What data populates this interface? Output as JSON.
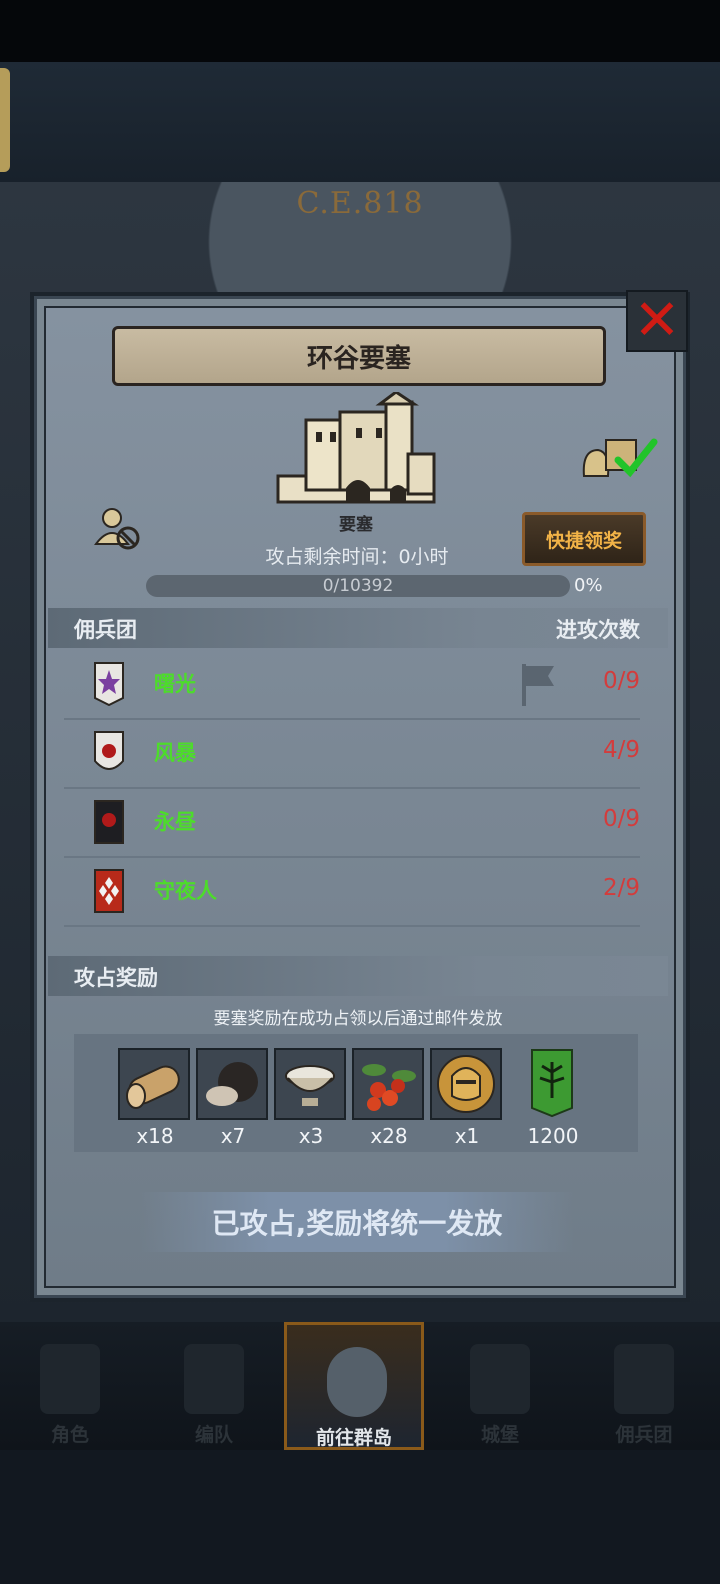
{
  "era": "C.E.818",
  "modal": {
    "title": "环谷要塞",
    "building_label": "要塞",
    "quick_claim_label": "快捷领奖",
    "time_label": "攻占剩余时间：0小时",
    "progress": {
      "text": "0/10392",
      "percent_label": "0%",
      "fraction": 0.0
    }
  },
  "mercenary_section": {
    "title": "佣兵团",
    "attack_count_header": "进攻次数",
    "rows": [
      {
        "name": "曙光",
        "count": "0/9",
        "banner_color": "#e8e6e2",
        "emblem_color": "#7a3fa0",
        "flag": true
      },
      {
        "name": "风暴",
        "count": "4/9",
        "banner_color": "#e8e6e2",
        "emblem_color": "#b01a1a",
        "flag": false
      },
      {
        "name": "永昼",
        "count": "0/9",
        "banner_color": "#1e1e22",
        "emblem_color": "#b01a1a",
        "flag": false
      },
      {
        "name": "守夜人",
        "count": "2/9",
        "banner_color": "#b82a1a",
        "emblem_color": "#f2f2f2",
        "flag": false
      }
    ]
  },
  "reward_section": {
    "title": "攻占奖励",
    "note": "要塞奖励在成功占领以后通过邮件发放",
    "items": [
      {
        "icon": "wood-log-icon",
        "qty": "x18"
      },
      {
        "icon": "truffle-icon",
        "qty": "x7"
      },
      {
        "icon": "salt-bowl-icon",
        "qty": "x3"
      },
      {
        "icon": "berries-icon",
        "qty": "x28"
      },
      {
        "icon": "knight-helmet-icon",
        "qty": "x1"
      },
      {
        "icon": "tree-banner-icon",
        "qty": "1200"
      }
    ]
  },
  "status_banner": "已攻占,奖励将统一发放",
  "nav": {
    "items": [
      {
        "label": "角色",
        "icon": "knight-icon"
      },
      {
        "label": "编队",
        "icon": "helmet-icon"
      },
      {
        "label": "前往群岛",
        "icon": "globe-icon",
        "active": true
      },
      {
        "label": "城堡",
        "icon": "castle-icon"
      },
      {
        "label": "佣兵团",
        "icon": "mercenary-icon"
      }
    ]
  }
}
